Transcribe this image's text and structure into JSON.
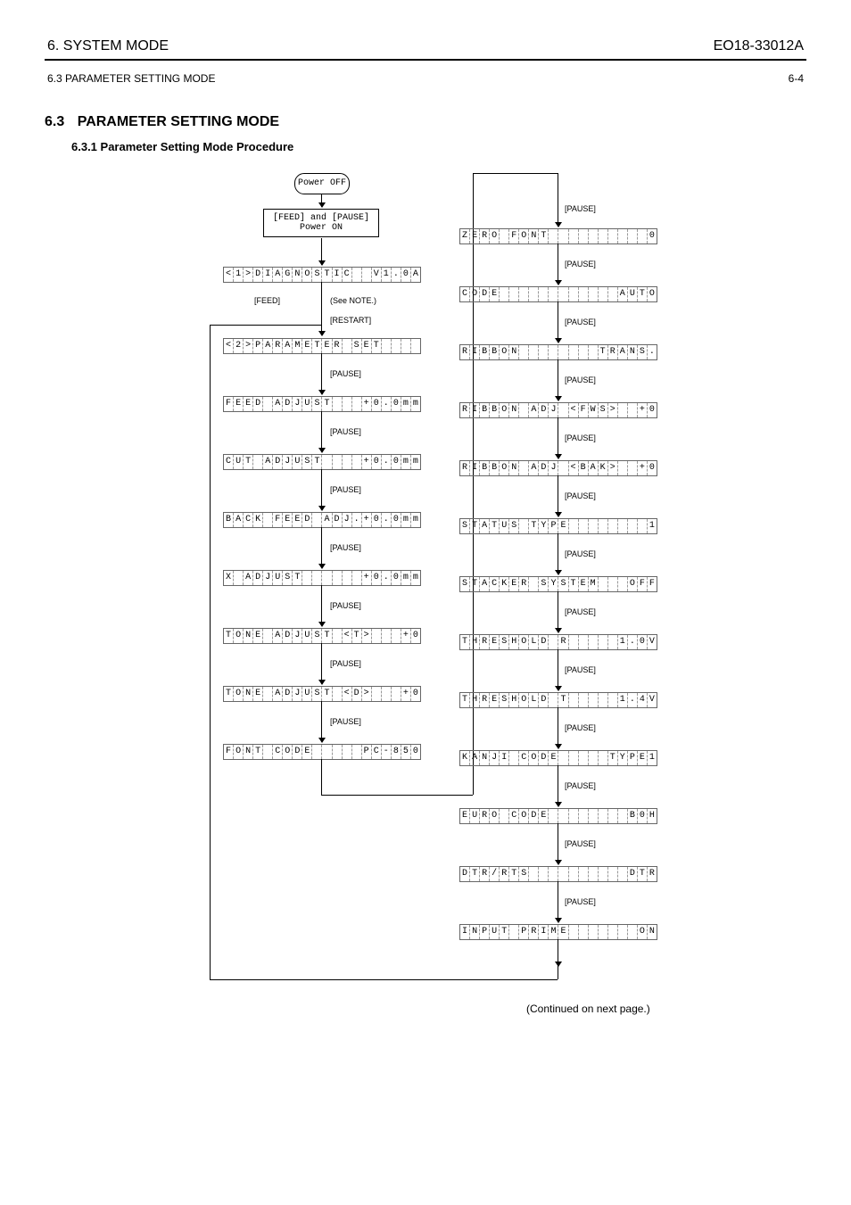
{
  "header": {
    "title": "6. SYSTEM MODE",
    "eo_label": "EO18-33012A",
    "sub_section": "6.3 PARAMETER SETTING MODE",
    "page": "6-4"
  },
  "section": {
    "number": "6.3",
    "title": "PARAMETER SETTING MODE",
    "subtitle": "6.3.1 Parameter Setting Mode Procedure"
  },
  "start": "Power OFF",
  "box1_l1": "[FEED] and [PAUSE]",
  "box1_l2": "Power ON",
  "keys": {
    "feed": "[FEED]",
    "restart": "[RESTART]",
    "pause": "[PAUSE]"
  },
  "note": "(See NOTE.)",
  "lcds": {
    "l1": "<1>DIAGNOSTIC  V1.0A",
    "l2": "<2>PARAMETER SET    ",
    "l3": "FEED ADJUST   +0.0mm",
    "l4": "CUT ADJUST    +0.0mm",
    "l5": "BACK FEED ADJ.+0.0mm",
    "l6": "X ADJUST      +0.0mm",
    "l7": "TONE ADJUST <T>   +0",
    "l8": "TONE ADJUST <D>   +0",
    "l9": "FONT CODE     PC-850",
    "r1": "ZERO FONT          0",
    "r2": "CODE            AUTO",
    "r3": "RIBBON        TRANS.",
    "r4": "RIBBON ADJ <FWS>  +0",
    "r5": "RIBBON ADJ <BAK>  +0",
    "r6": "STATUS TYPE        1",
    "r7": "STACKER SYSTEM   OFF",
    "r8": "THRESHOLD R     1.0V",
    "r9": "THRESHOLD T     1.4V",
    "r10": "KANJI CODE     TYPE1",
    "r11": "EURO CODE        B0H",
    "r12": "DTR/RTS          DTR",
    "r13": "INPUT PRIME       ON"
  },
  "continue": "(Continued on next page.)",
  "chart_data": {
    "type": "flowchart",
    "description": "Parameter setting mode procedure flowchart with LCD display states",
    "nodes_left": [
      {
        "kind": "oval",
        "text": "Power OFF"
      },
      {
        "kind": "box",
        "text": "[FEED] and [PAUSE] Power ON"
      },
      {
        "kind": "lcd",
        "text": "<1>DIAGNOSTIC  V1.0A"
      },
      {
        "kind": "lcd",
        "text": "<2>PARAMETER SET"
      },
      {
        "kind": "lcd",
        "text": "FEED ADJUST   +0.0mm",
        "key": "[PAUSE]"
      },
      {
        "kind": "lcd",
        "text": "CUT ADJUST    +0.0mm",
        "key": "[PAUSE]"
      },
      {
        "kind": "lcd",
        "text": "BACK FEED ADJ.+0.0mm",
        "key": "[PAUSE]"
      },
      {
        "kind": "lcd",
        "text": "X ADJUST      +0.0mm",
        "key": "[PAUSE]"
      },
      {
        "kind": "lcd",
        "text": "TONE ADJUST <T>   +0",
        "key": "[PAUSE]"
      },
      {
        "kind": "lcd",
        "text": "TONE ADJUST <D>   +0",
        "key": "[PAUSE]"
      },
      {
        "kind": "lcd",
        "text": "FONT CODE     PC-850",
        "key": "[PAUSE]"
      }
    ],
    "nodes_right": [
      {
        "kind": "lcd",
        "text": "ZERO FONT          0",
        "key": "[PAUSE]"
      },
      {
        "kind": "lcd",
        "text": "CODE            AUTO",
        "key": "[PAUSE]"
      },
      {
        "kind": "lcd",
        "text": "RIBBON        TRANS.",
        "key": "[PAUSE]"
      },
      {
        "kind": "lcd",
        "text": "RIBBON ADJ <FWS>  +0",
        "key": "[PAUSE]"
      },
      {
        "kind": "lcd",
        "text": "RIBBON ADJ <BAK>  +0",
        "key": "[PAUSE]"
      },
      {
        "kind": "lcd",
        "text": "STATUS TYPE        1",
        "key": "[PAUSE]"
      },
      {
        "kind": "lcd",
        "text": "STACKER SYSTEM   OFF",
        "key": "[PAUSE]"
      },
      {
        "kind": "lcd",
        "text": "THRESHOLD R     1.0V",
        "key": "[PAUSE]"
      },
      {
        "kind": "lcd",
        "text": "THRESHOLD T     1.4V",
        "key": "[PAUSE]"
      },
      {
        "kind": "lcd",
        "text": "KANJI CODE     TYPE1",
        "key": "[PAUSE]"
      },
      {
        "kind": "lcd",
        "text": "EURO CODE        B0H",
        "key": "[PAUSE]"
      },
      {
        "kind": "lcd",
        "text": "DTR/RTS          DTR",
        "key": "[PAUSE]"
      },
      {
        "kind": "lcd",
        "text": "INPUT PRIME       ON",
        "key": "[PAUSE]"
      }
    ],
    "pre_keys": [
      "[FEED]",
      "(See NOTE.)",
      "[RESTART]"
    ]
  }
}
